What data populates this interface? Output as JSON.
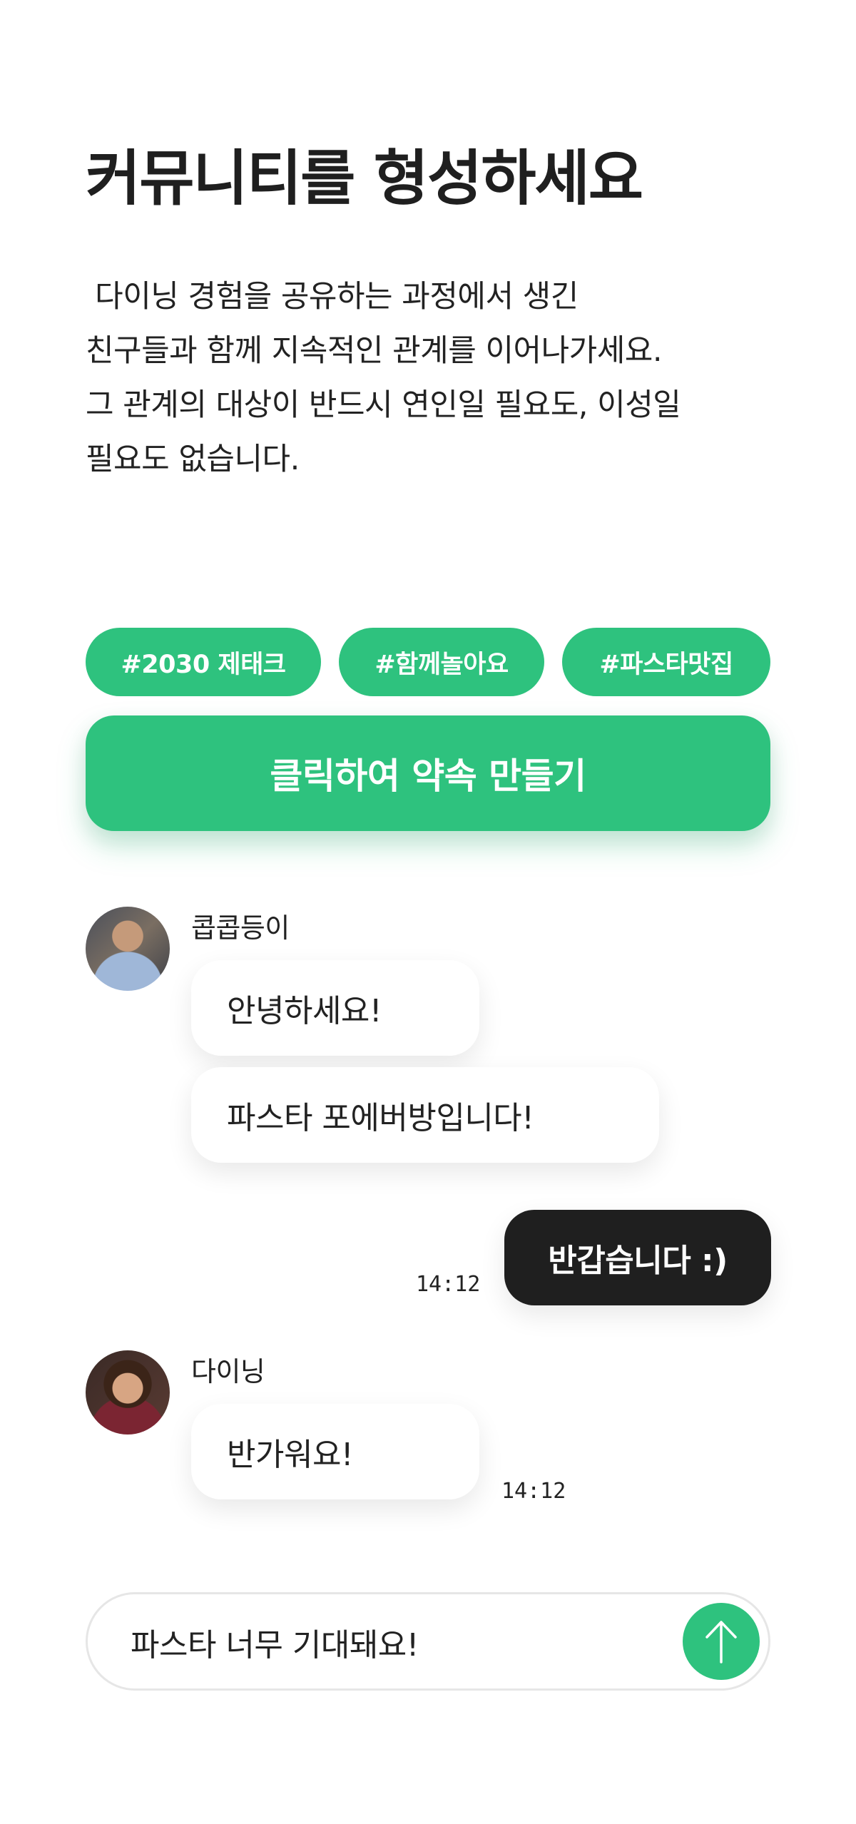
{
  "header": {
    "title": "커뮤니티를 형성하세요",
    "description_lines": [
      " 다이닝 경험을 공유하는 과정에서 생긴",
      "친구들과 함께 지속적인 관계를 이어나가세요.",
      "그 관계의 대상이 반드시 연인일 필요도, 이성일",
      "필요도 없습니다."
    ]
  },
  "tags": [
    "#2030 제태크",
    "#함께놀아요",
    "#파스타맛집"
  ],
  "cta": {
    "label": "클릭하여 약속 만들기"
  },
  "chat": {
    "user1": {
      "name": "콥콥등이",
      "avatar_icon": "user-avatar-man",
      "messages": [
        "안녕하세요!",
        "파스타 포에버방입니다!"
      ]
    },
    "mine": {
      "message": "반갑습니다 :)",
      "time": "14:12"
    },
    "user2": {
      "name": "다이닝",
      "avatar_icon": "user-avatar-woman",
      "messages": [
        "반가워요!"
      ],
      "time": "14:12"
    }
  },
  "composer": {
    "value": "파스타 너무 기대돼요!",
    "send_icon": "arrow-up-icon"
  },
  "colors": {
    "accent": "#2ec27e",
    "dark_bubble": "#1f1f1f",
    "text": "#1f1f1f"
  }
}
